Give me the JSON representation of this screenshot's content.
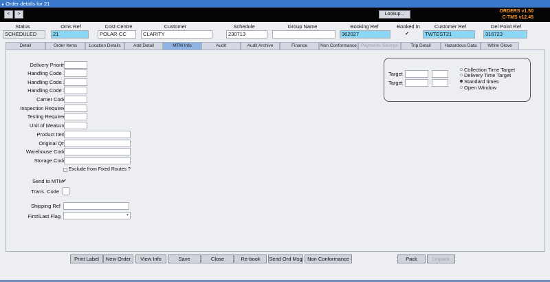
{
  "window": {
    "title": "Order details for 21"
  },
  "nav": {
    "prev": "<",
    "next": ">"
  },
  "header": {
    "lookup_label": "Lookup...",
    "version_orders": "ORDERS v1.50",
    "version_ctms": "C-TMS v12.45",
    "labels": {
      "status": "Status",
      "oms_ref": "Oms Ref",
      "cost_centre": "Cost Centre",
      "customer": "Customer",
      "schedule": "Schedule",
      "group_name": "Group Name",
      "booking_ref": "Booking Ref",
      "booked_in": "Booked In",
      "customer_ref": "Customer Ref",
      "del_point_ref": "Del Point Ref"
    },
    "values": {
      "status": "SCHEDULED",
      "oms_ref": "21",
      "cost_centre": "POLAR-CC",
      "customer": "CLARITY",
      "schedule": "230713",
      "group_name": "",
      "booking_ref": "362027",
      "booked_in": "✔",
      "customer_ref": "TWTEST21",
      "del_point_ref": "316723"
    }
  },
  "tabs": [
    "Detail",
    "Order Items",
    "Location Details",
    "Add Detail",
    "MTM Info",
    "Audit",
    "Audit Archive",
    "Finance",
    "Non Conformance",
    "Payments  Savings",
    "Trip Detail",
    "Hazardous Data",
    "White Glove"
  ],
  "form": {
    "delivery_priority": "Delivery Priority",
    "handling_code_1": "Handling Code 1",
    "handling_code_2": "Handling Code 2",
    "handling_code_3": "Handling Code 3",
    "carrier_code": "Carrier Code",
    "inspection_required": "Inspection Required",
    "testing_required": "Testing Required",
    "unit_of_measure": "Unit of Measure",
    "product_item": "Product Item",
    "original_qty": "Original Qty",
    "warehouse_code": "Warehouse Code",
    "storage_code": "Storage Code",
    "exclude_fixed_routes": "Exclude from Fixed Routes ?",
    "send_to_mtm": "Send to MTM",
    "send_to_mtm_tick": "✔",
    "trans_code": "Trans. Code",
    "shipping_ref": "Shipping Ref",
    "first_last_flag": "First/Last Flag"
  },
  "target_box": {
    "target_label": "Target",
    "options": [
      "Collection Time Target",
      "Delivery Time Target",
      "Standard times",
      "Open Window"
    ],
    "selected": "Standard times"
  },
  "buttons": [
    "Print Label",
    "New Order",
    "View Info",
    "Save",
    "Close",
    "Re-book",
    "Send Ord Msg",
    "Non Conformance",
    "Pack",
    "Unpack"
  ]
}
